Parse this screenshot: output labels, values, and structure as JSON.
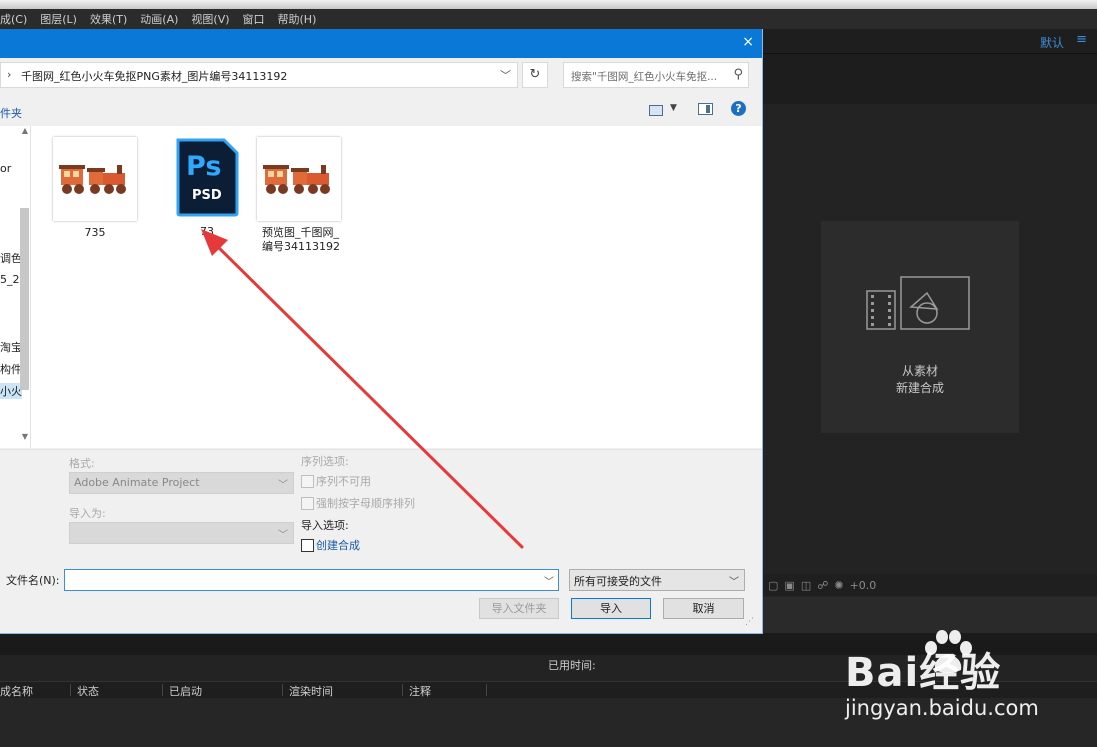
{
  "menu": [
    "成(C)",
    "图层(L)",
    "效果(T)",
    "动画(A)",
    "视图(V)",
    "窗口",
    "帮助(H)"
  ],
  "workspace": {
    "default_label": "默认",
    "menu_glyph": "≡"
  },
  "composition": {
    "new_comp_line1": "从素材",
    "new_comp_line2": "新建合成",
    "toolbar_readout": "+0.0"
  },
  "render_queue": {
    "elapsed_label": "已用时间:",
    "columns": [
      "成名称",
      "状态",
      "已启动",
      "渲染时间",
      "注释"
    ]
  },
  "dialog": {
    "close_glyph": "×",
    "address": {
      "separator": "›",
      "path": "千图网_红色小火车免抠PNG素材_图片编号34113192"
    },
    "search_placeholder": "搜索\"千图网_红色小火车免抠...",
    "new_folder_fragment": "件夹",
    "nav_fragments": [
      "or",
      "调色",
      "5_2",
      "淘宝",
      "构件",
      "小火"
    ],
    "files": [
      {
        "name": "735",
        "type": "png"
      },
      {
        "name": "73",
        "type": "psd"
      },
      {
        "name_line1": "预览图_千图网_",
        "name_line2": "编号34113192",
        "type": "png"
      }
    ],
    "psd_badge": {
      "ps": "Ps",
      "ext": "PSD"
    },
    "options": {
      "format_label": "格式:",
      "format_value": "Adobe Animate Project",
      "import_as_label": "导入为:",
      "sequence_label": "序列选项:",
      "sequence_unavailable": "序列不可用",
      "force_alpha": "强制按字母顺序排列",
      "import_options_label": "导入选项:",
      "create_comp": "创建合成"
    },
    "filename_label": "文件名(N):",
    "filename_value": "",
    "filetype_value": "所有可接受的文件",
    "buttons": {
      "import_folder": "导入文件夹",
      "import": "导入",
      "cancel": "取消"
    }
  },
  "watermark": {
    "brand": "Bai经验",
    "url": "jingyan.baidu.com"
  },
  "colors": {
    "dialog_title": "#0a78d7",
    "annotation_arrow": "#e63a3a",
    "ae_accent": "#3c8edc"
  }
}
